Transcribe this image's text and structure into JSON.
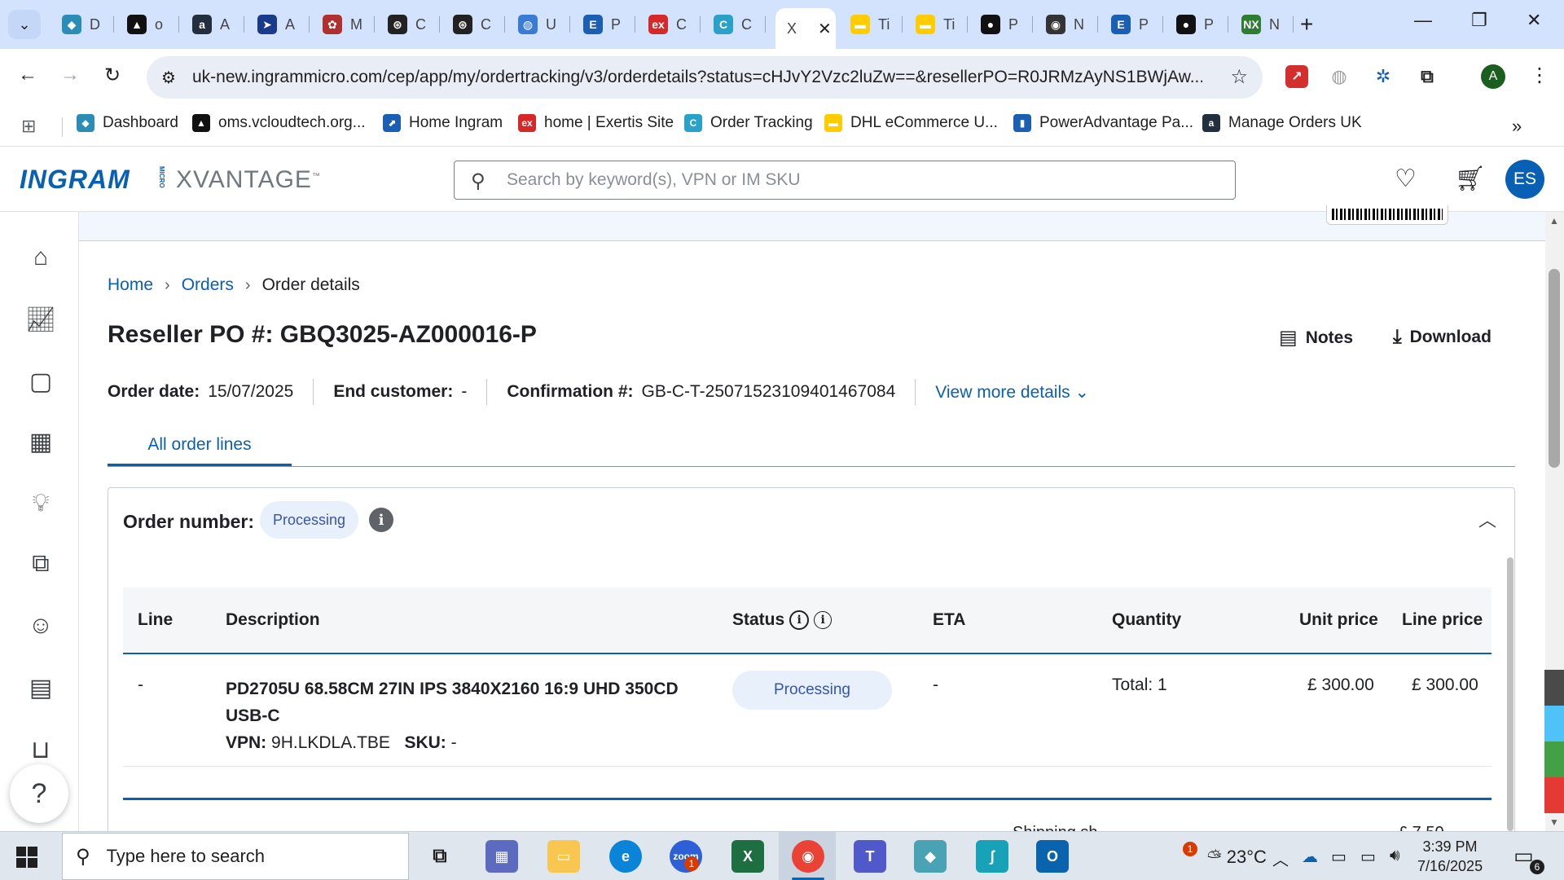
{
  "browser": {
    "tabs": [
      {
        "text": "D",
        "color": "#2a8db5",
        "glyph": "◆"
      },
      {
        "text": "o",
        "color": "#111111",
        "glyph": "▲"
      },
      {
        "text": "A",
        "color": "#232f3e",
        "glyph": "a"
      },
      {
        "text": "A",
        "color": "#1a3a8a",
        "glyph": "➤"
      },
      {
        "text": "M",
        "color": "#b03030",
        "glyph": "✿"
      },
      {
        "text": "C",
        "color": "#222222",
        "glyph": "⊛"
      },
      {
        "text": "C",
        "color": "#222222",
        "glyph": "⊛"
      },
      {
        "text": "U",
        "color": "#3a7bd5",
        "glyph": "◍"
      },
      {
        "text": "P",
        "color": "#1a5fb4",
        "glyph": "E"
      },
      {
        "text": "C",
        "color": "#d62828",
        "glyph": "ex"
      },
      {
        "text": "C",
        "color": "#2aa1c9",
        "glyph": "C"
      }
    ],
    "active_tab": {
      "text": "X",
      "close": "✕"
    },
    "tabs_after": [
      {
        "text": "Ti",
        "color": "#ffcc00",
        "glyph": "▬"
      },
      {
        "text": "Ti",
        "color": "#ffcc00",
        "glyph": "▬"
      },
      {
        "text": "P",
        "color": "#111111",
        "glyph": "●"
      },
      {
        "text": "N",
        "color": "#333333",
        "glyph": "◉"
      },
      {
        "text": "P",
        "color": "#1a5fb4",
        "glyph": "E"
      },
      {
        "text": "P",
        "color": "#111111",
        "glyph": "●"
      },
      {
        "text": "N",
        "color": "#2e7d32",
        "glyph": "NX"
      }
    ],
    "url": "uk-new.ingrammicro.com/cep/app/my/ordertracking/v3/orderdetails?status=cHJvY2Vzc2luZw==&resellerPO=R0JRMzAyNS1BWjAw...",
    "profile_initial": "A",
    "bookmarks": [
      {
        "label": "Dashboard",
        "color": "#2a8db5",
        "glyph": "◆"
      },
      {
        "label": "oms.vcloudtech.org...",
        "color": "#111111",
        "glyph": "▲"
      },
      {
        "label": "Home Ingram",
        "color": "#1a5fb4",
        "glyph": "⬈"
      },
      {
        "label": "home | Exertis Site",
        "color": "#d62828",
        "glyph": "ex"
      },
      {
        "label": "Order Tracking",
        "color": "#2aa1c9",
        "glyph": "C"
      },
      {
        "label": "DHL eCommerce U...",
        "color": "#ffcc00",
        "glyph": "▬"
      },
      {
        "label": "PowerAdvantage Pa...",
        "color": "#1a5fb4",
        "glyph": "▮"
      },
      {
        "label": "Manage Orders UK",
        "color": "#232f3e",
        "glyph": "a"
      }
    ]
  },
  "app": {
    "logo_main": "INGRAM",
    "logo_micro": "MICRO",
    "logo_sub": "XVANTAGE",
    "search_placeholder": "Search by keyword(s), VPN or IM SKU",
    "user_initials": "ES",
    "brand_color": "#0860b4"
  },
  "breadcrumb": {
    "home": "Home",
    "orders": "Orders",
    "current": "Order details"
  },
  "order": {
    "title": "Reseller PO #: GBQ3025-AZ000016-P",
    "notes_label": "Notes",
    "download_label": "Download",
    "order_date_label": "Order date:",
    "order_date": "15/07/2025",
    "end_customer_label": "End customer:",
    "end_customer": "-",
    "confirmation_label": "Confirmation #:",
    "confirmation": "GB-C-T-25071523109401467084",
    "view_more": "View more details"
  },
  "tabs": {
    "all_lines": "All order lines"
  },
  "card": {
    "title": "Order number:",
    "status": "Processing",
    "columns": {
      "line": "Line",
      "description": "Description",
      "status": "Status",
      "eta": "ETA",
      "quantity": "Quantity",
      "unit_price": "Unit price",
      "line_price": "Line price"
    },
    "row": {
      "line": "-",
      "description": "PD2705U 68.58CM 27IN IPS 3840X2160 16:9 UHD 350CD USB-C",
      "vpn_label": "VPN:",
      "vpn": "9H.LKDLA.TBE",
      "sku_label": "SKU:",
      "sku": "-",
      "status": "Processing",
      "eta": "-",
      "quantity": "Total: 1",
      "unit_price": "£ 300.00",
      "line_price": "£ 300.00"
    },
    "ship_label_partial": "Shipping sh",
    "ship_value_partial": "£ 7.50"
  },
  "taskbar": {
    "search_text": "Type here to search",
    "weather": "23°C",
    "weather_badge": "1",
    "time": "3:39 PM",
    "date": "7/16/2025",
    "notif_count": "6",
    "zoom_badge": "1"
  }
}
